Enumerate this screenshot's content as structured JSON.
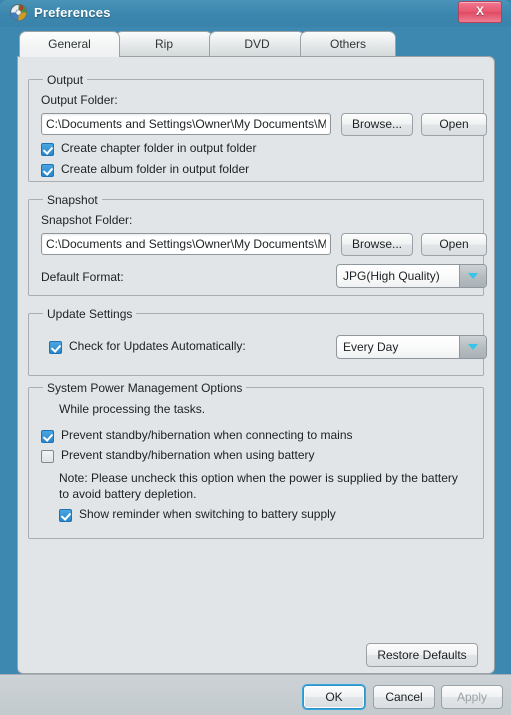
{
  "window": {
    "title": "Preferences",
    "icon": "disc-icon",
    "close_label": "X",
    "accent_color": "#3d88b0",
    "panel_color": "#e2e5e7",
    "close_color": "#e8566f"
  },
  "tabs": [
    {
      "label": "General",
      "active": true
    },
    {
      "label": "Rip",
      "active": false
    },
    {
      "label": "DVD",
      "active": false
    },
    {
      "label": "Others",
      "active": false
    }
  ],
  "output": {
    "group_title": "Output",
    "folder_label": "Output Folder:",
    "folder_value": "C:\\Documents and Settings\\Owner\\My Documents\\My Vid",
    "browse_label": "Browse...",
    "open_label": "Open",
    "chapter_checkbox": {
      "label": "Create chapter folder in output folder",
      "checked": true
    },
    "album_checkbox": {
      "label": "Create album folder in output folder",
      "checked": true
    }
  },
  "snapshot": {
    "group_title": "Snapshot",
    "folder_label": "Snapshot Folder:",
    "folder_value": "C:\\Documents and Settings\\Owner\\My Documents\\My Pic",
    "browse_label": "Browse...",
    "open_label": "Open",
    "format_label": "Default Format:",
    "format_value": "JPG(High Quality)"
  },
  "update": {
    "group_title": "Update Settings",
    "check_checkbox": {
      "label": "Check for Updates Automatically:",
      "checked": true
    },
    "frequency_value": "Every Day"
  },
  "power": {
    "group_title": "System Power Management Options",
    "intro": "While processing the tasks.",
    "mains_checkbox": {
      "label": "Prevent standby/hibernation when connecting to mains",
      "checked": true
    },
    "battery_checkbox": {
      "label": "Prevent standby/hibernation when using battery",
      "checked": false
    },
    "note": "Note: Please uncheck this option when the power is supplied by the battery to avoid battery depletion.",
    "reminder_checkbox": {
      "label": "Show reminder when switching to battery supply",
      "checked": true
    }
  },
  "actions": {
    "restore_defaults_label": "Restore Defaults",
    "ok_label": "OK",
    "cancel_label": "Cancel",
    "apply_label": "Apply",
    "apply_enabled": false
  }
}
